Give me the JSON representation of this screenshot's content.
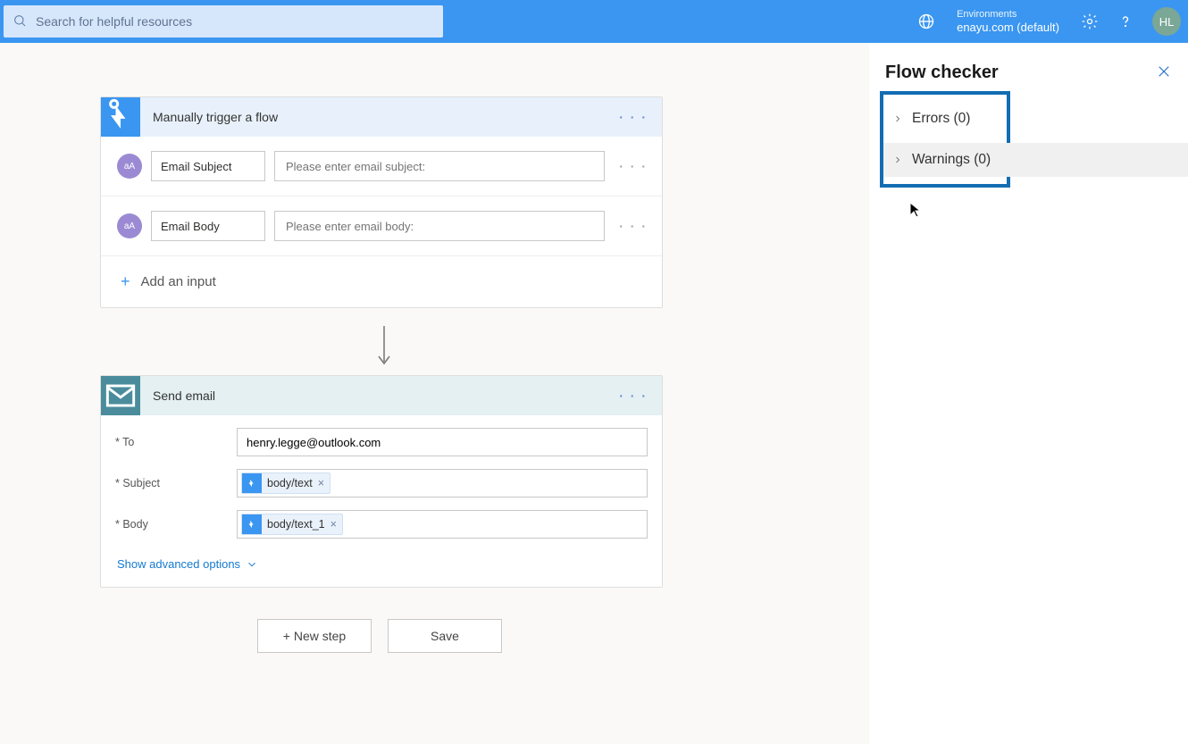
{
  "topbar": {
    "search_placeholder": "Search for helpful resources",
    "env_label": "Environments",
    "env_name": "enayu.com (default)",
    "avatar": "HL"
  },
  "trigger": {
    "title": "Manually trigger a flow",
    "inputs": [
      {
        "label": "Email Subject",
        "placeholder": "Please enter email subject:",
        "badge": "aA"
      },
      {
        "label": "Email Body",
        "placeholder": "Please enter email body:",
        "badge": "aA"
      }
    ],
    "add_label": "Add an input"
  },
  "send": {
    "title": "Send email",
    "fields": {
      "to_label": "* To",
      "to_value": "henry.legge@outlook.com",
      "subject_label": "* Subject",
      "subject_token": "body/text",
      "body_label": "* Body",
      "body_token": "body/text_1"
    },
    "advanced": "Show advanced options"
  },
  "buttons": {
    "new_step": "+ New step",
    "save": "Save"
  },
  "checker": {
    "title": "Flow checker",
    "errors": "Errors (0)",
    "warnings": "Warnings (0)"
  }
}
